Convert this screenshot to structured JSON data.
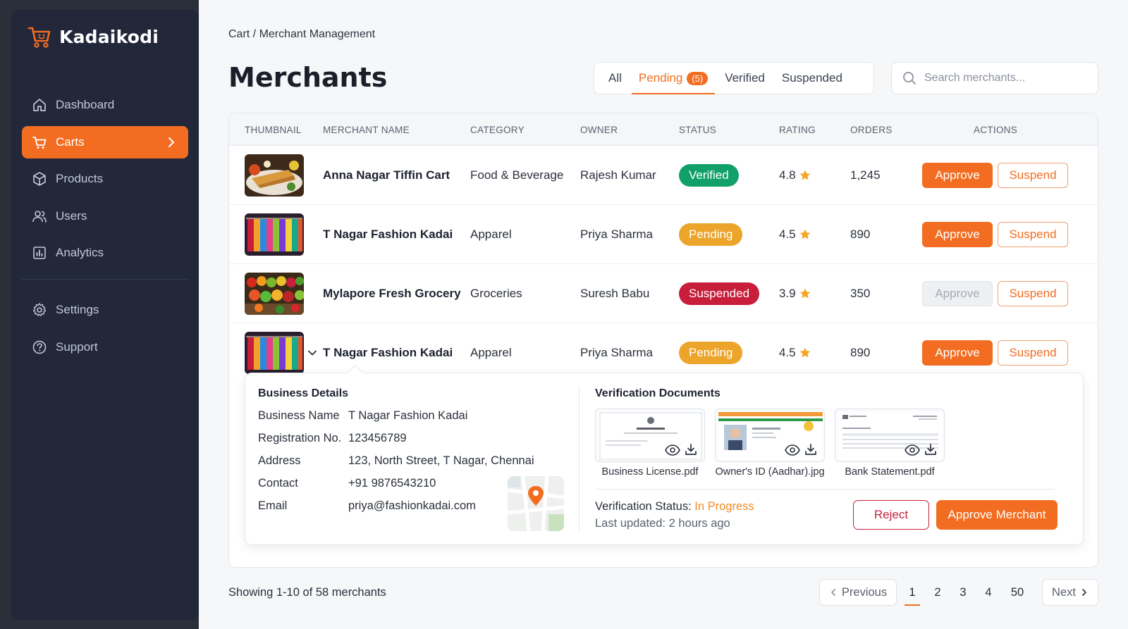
{
  "brand": {
    "name": "Kadaikodi"
  },
  "sidebar": {
    "items": [
      {
        "label": "Dashboard",
        "icon": "home-icon"
      },
      {
        "label": "Carts",
        "icon": "cart-icon",
        "active": true
      },
      {
        "label": "Products",
        "icon": "box-icon"
      },
      {
        "label": "Users",
        "icon": "users-icon"
      },
      {
        "label": "Analytics",
        "icon": "chart-icon"
      }
    ],
    "secondary": [
      {
        "label": "Settings",
        "icon": "gear-icon"
      },
      {
        "label": "Support",
        "icon": "help-icon"
      }
    ]
  },
  "header": {
    "breadcrumb": "Cart / Merchant Management",
    "title": "Merchants"
  },
  "tabs": {
    "all": "All",
    "pending": "Pending",
    "pending_count": "(5)",
    "verified": "Verified",
    "suspended": "Suspended",
    "active": "Pending"
  },
  "search": {
    "placeholder": "Search merchants..."
  },
  "table": {
    "columns": [
      "THUMBNAIL",
      "MERCHANT NAME",
      "CATEGORY",
      "OWNER",
      "STATUS",
      "RATING",
      "ORDERS",
      "ACTIONS"
    ],
    "rows": [
      {
        "name": "Anna Nagar Tiffin Cart",
        "category": "Food & Beverage",
        "owner": "Rajesh Kumar",
        "status": "Verified",
        "rating": "4.8",
        "orders": "1,245",
        "approve": "Approve",
        "suspend": "Suspend"
      },
      {
        "name": "T Nagar Fashion Kadai",
        "category": "Apparel",
        "owner": "Priya Sharma",
        "status": "Pending",
        "rating": "4.5",
        "orders": "890",
        "approve": "Approve",
        "suspend": "Suspend"
      },
      {
        "name": "Mylapore Fresh Grocery",
        "category": "Groceries",
        "owner": "Suresh Babu",
        "status": "Suspended",
        "rating": "3.9",
        "orders": "350",
        "approve": "Approve",
        "suspend": "Suspend"
      },
      {
        "name": "T Nagar Fashion Kadai",
        "category": "Apparel",
        "owner": "Priya Sharma",
        "status": "Pending",
        "rating": "4.5",
        "orders": "890",
        "approve": "Approve",
        "suspend": "Suspend"
      }
    ]
  },
  "details": {
    "business_title": "Business Details",
    "fields": [
      {
        "label": "Business Name",
        "value": "T Nagar Fashion Kadai"
      },
      {
        "label": "Registration No.",
        "value": "123456789"
      },
      {
        "label": "Address",
        "value": "123, North Street, T Nagar, Chennai"
      },
      {
        "label": "Contact",
        "value": "+91 9876543210"
      },
      {
        "label": "Email",
        "value": "priya@fashionkadai.com"
      }
    ],
    "docs_title": "Verification Documents",
    "documents": [
      {
        "name": "Business License.pdf"
      },
      {
        "name": "Owner's ID (Aadhar).jpg"
      },
      {
        "name": "Bank Statement.pdf"
      }
    ],
    "status_label": "Verification Status:",
    "status_value": "In Progress",
    "updated": "Last updated: 2 hours ago",
    "reject": "Reject",
    "approve_merchant": "Approve Merchant"
  },
  "footer": {
    "showing": "Showing 1-10 of 58 merchants",
    "previous": "Previous",
    "next": "Next",
    "pages": [
      "1",
      "2",
      "3",
      "4",
      "50"
    ]
  },
  "colors": {
    "accent": "#f26d21",
    "verified": "#11a06a",
    "pending": "#eca42a",
    "suspended": "#c81e3c",
    "sidebar": "#22283a"
  }
}
